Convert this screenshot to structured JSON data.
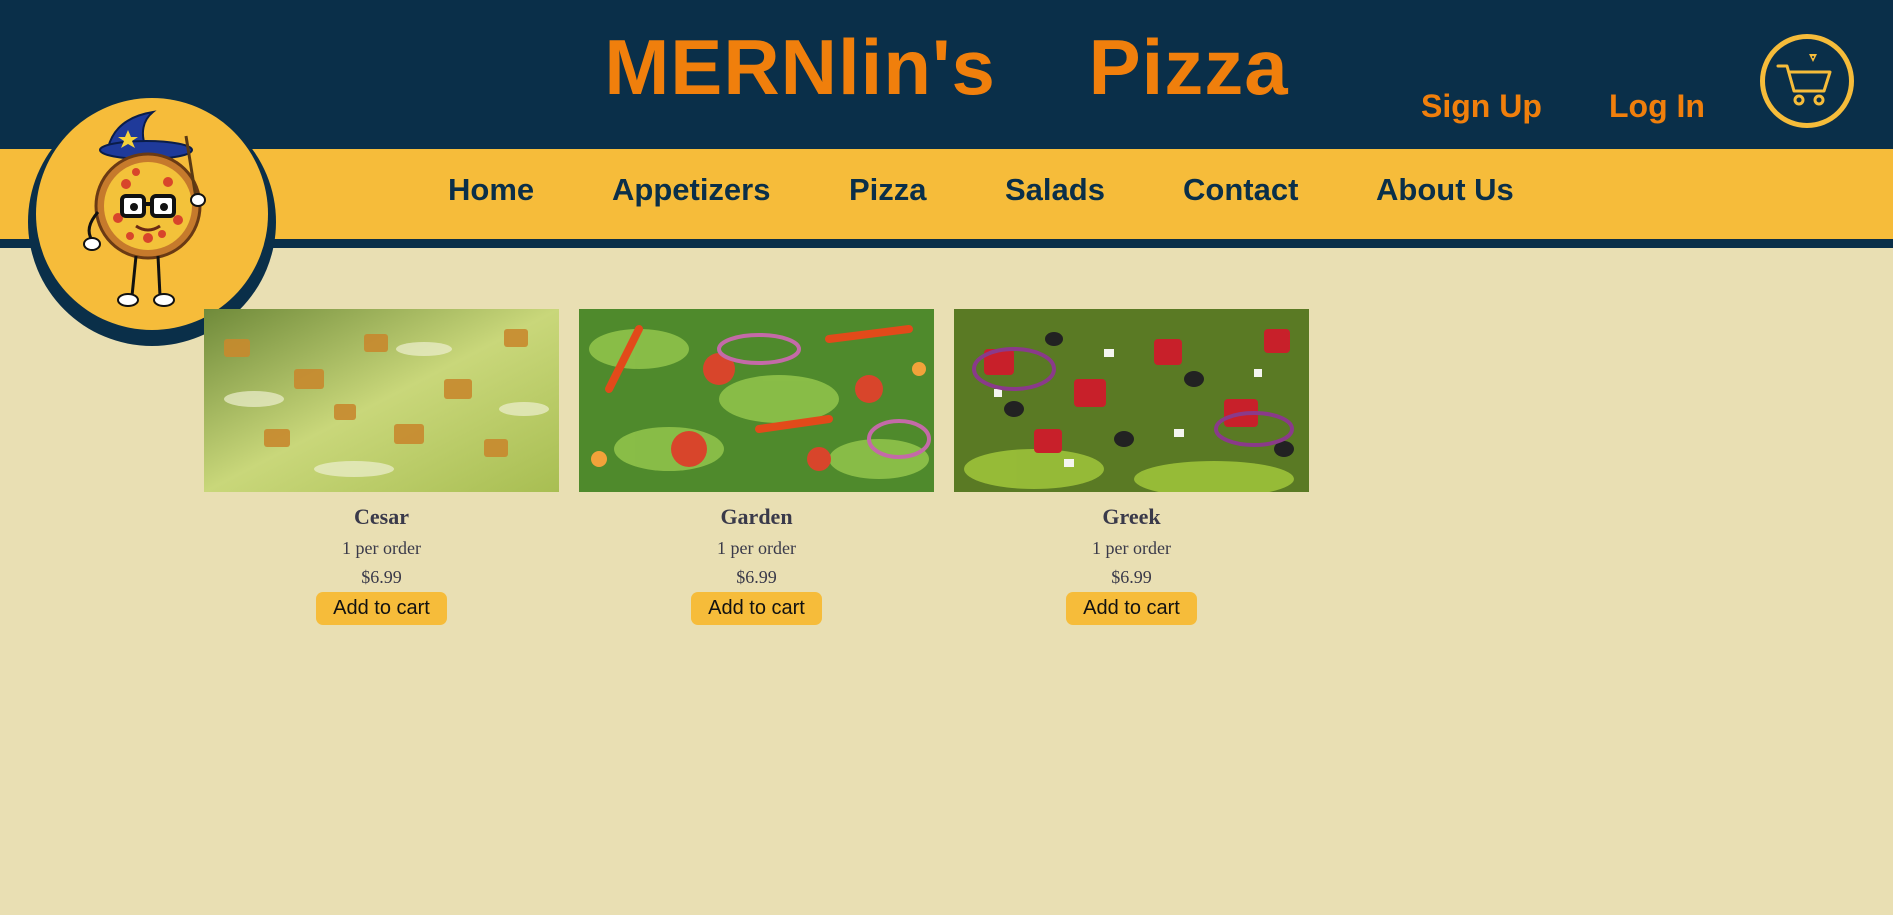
{
  "header": {
    "brand": "MERNlin's Pizza",
    "sign_up": "Sign Up",
    "log_in": "Log In",
    "cart_icon": "shopping-cart-icon",
    "logo_icon": "wizard-pizza-mascot-logo"
  },
  "nav": {
    "items": [
      {
        "label": "Home"
      },
      {
        "label": "Appetizers"
      },
      {
        "label": "Pizza"
      },
      {
        "label": "Salads"
      },
      {
        "label": "Contact"
      },
      {
        "label": "About Us"
      }
    ]
  },
  "products": [
    {
      "name": "Cesar",
      "qty": "1 per order",
      "price": "$6.99",
      "button": "Add to cart"
    },
    {
      "name": "Garden",
      "qty": "1 per order",
      "price": "$6.99",
      "button": "Add to cart"
    },
    {
      "name": "Greek",
      "qty": "1 per order",
      "price": "$6.99",
      "button": "Add to cart"
    }
  ],
  "colors": {
    "navy": "#0a2f49",
    "brand_orange": "#f07f0c",
    "nav_yellow": "#f6bc3a",
    "page_bg": "#e9dfb3"
  }
}
